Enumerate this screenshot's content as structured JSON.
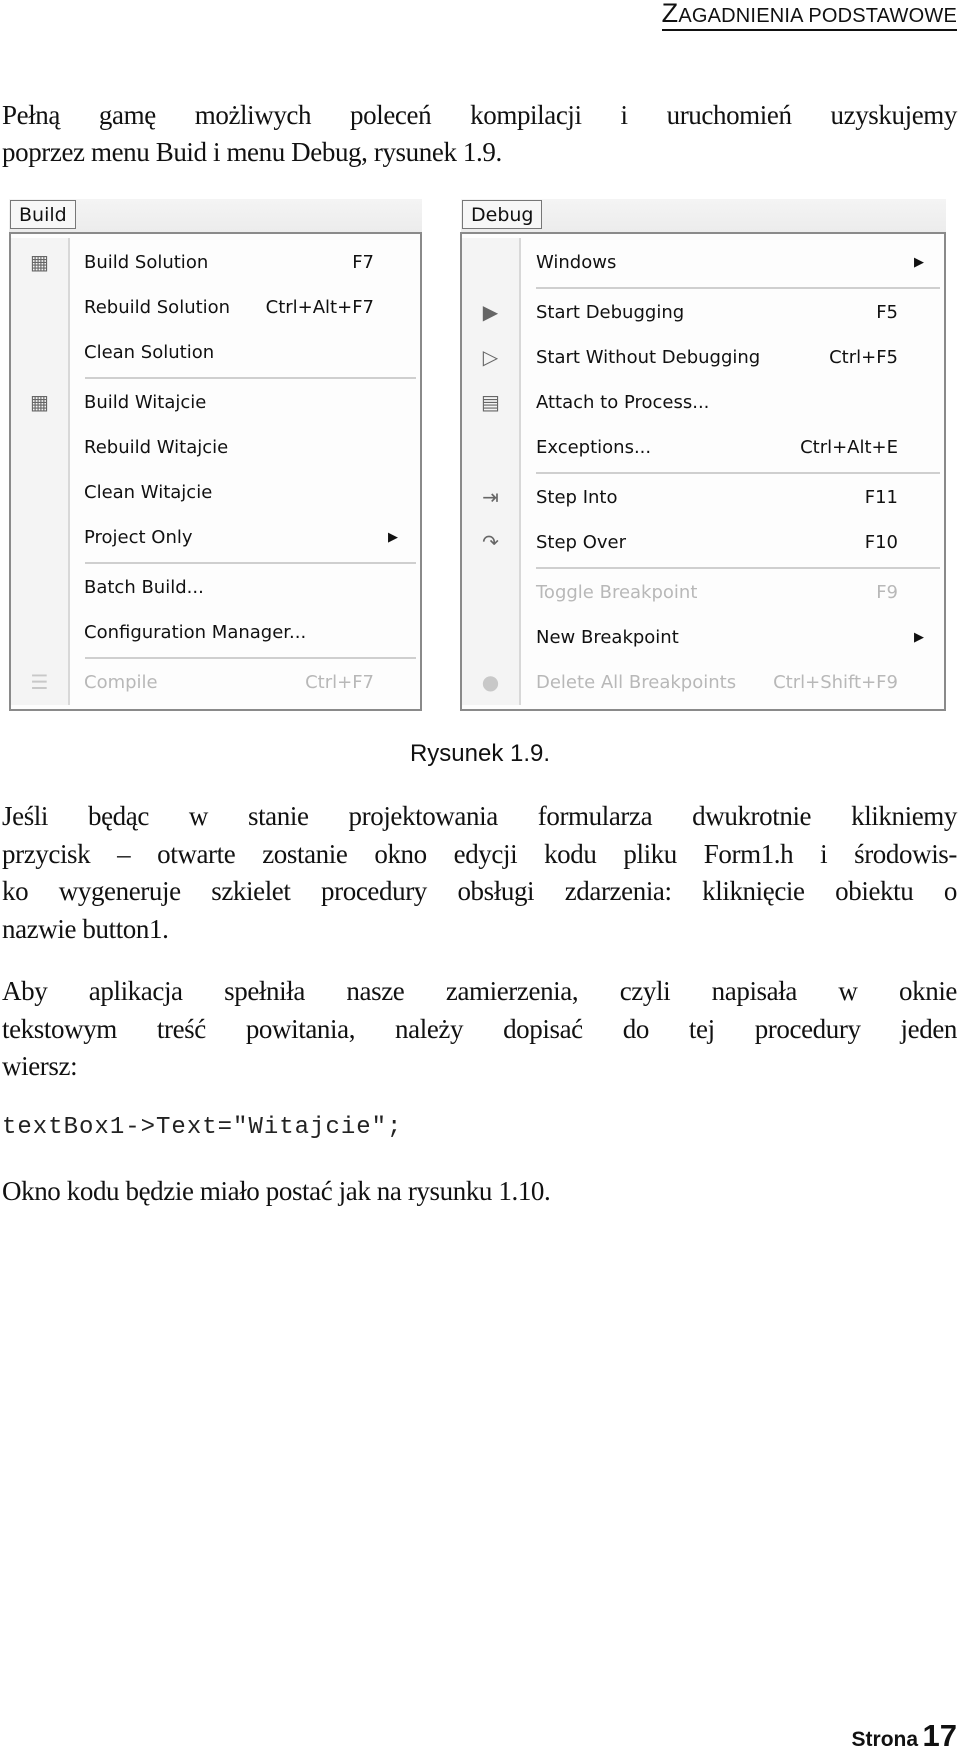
{
  "header": {
    "first_letter": "Z",
    "rest": "agadnienia podstawowe"
  },
  "intro": [
    "Pełną gamę możliwych poleceń kompilacji i uruchomień uzyskujemy",
    "poprzez menu Buid i menu Debug, rysunek 1.9."
  ],
  "build_menu": {
    "title": "Build",
    "items": [
      {
        "type": "item",
        "label": "Build Solution",
        "shortcut": "F7",
        "icon": "build-solution-icon"
      },
      {
        "type": "item",
        "label": "Rebuild Solution",
        "shortcut": "Ctrl+Alt+F7"
      },
      {
        "type": "item",
        "label": "Clean Solution",
        "shortcut": ""
      },
      {
        "type": "separator"
      },
      {
        "type": "item",
        "label": "Build Witajcie",
        "shortcut": "",
        "icon": "build-project-icon"
      },
      {
        "type": "item",
        "label": "Rebuild Witajcie",
        "shortcut": ""
      },
      {
        "type": "item",
        "label": "Clean Witajcie",
        "shortcut": ""
      },
      {
        "type": "item",
        "label": "Project Only",
        "shortcut": "",
        "submenu": true
      },
      {
        "type": "separator"
      },
      {
        "type": "item",
        "label": "Batch Build...",
        "shortcut": ""
      },
      {
        "type": "item",
        "label": "Configuration Manager...",
        "shortcut": ""
      },
      {
        "type": "separator"
      },
      {
        "type": "item",
        "label": "Compile",
        "shortcut": "Ctrl+F7",
        "disabled": true,
        "icon": "compile-icon"
      }
    ]
  },
  "debug_menu": {
    "title": "Debug",
    "items": [
      {
        "type": "item",
        "label": "Windows",
        "shortcut": "",
        "submenu": true
      },
      {
        "type": "separator"
      },
      {
        "type": "item",
        "label": "Start Debugging",
        "shortcut": "F5",
        "icon": "play-icon"
      },
      {
        "type": "item",
        "label": "Start Without Debugging",
        "shortcut": "Ctrl+F5",
        "icon": "play-outline-icon"
      },
      {
        "type": "item",
        "label": "Attach to Process...",
        "shortcut": "",
        "icon": "attach-process-icon"
      },
      {
        "type": "item",
        "label": "Exceptions...",
        "shortcut": "Ctrl+Alt+E"
      },
      {
        "type": "separator"
      },
      {
        "type": "item",
        "label": "Step Into",
        "shortcut": "F11",
        "icon": "step-into-icon"
      },
      {
        "type": "item",
        "label": "Step Over",
        "shortcut": "F10",
        "icon": "step-over-icon"
      },
      {
        "type": "separator"
      },
      {
        "type": "item",
        "label": "Toggle Breakpoint",
        "shortcut": "F9",
        "disabled": true
      },
      {
        "type": "item",
        "label": "New Breakpoint",
        "shortcut": "",
        "submenu": true
      },
      {
        "type": "item",
        "label": "Delete All Breakpoints",
        "shortcut": "Ctrl+Shift+F9",
        "disabled": true,
        "icon": "delete-breakpoints-icon"
      }
    ]
  },
  "caption": "Rysunek 1.9.",
  "para1": [
    "Jeśli będąc w stanie projektowania formularza dwukrotnie klikniemy",
    "przycisk – otwarte zostanie okno edycji kodu pliku Form1.h i środowis-",
    "ko wygeneruje szkielet procedury obsługi zdarzenia: kliknięcie obiektu o",
    "nazwie button1."
  ],
  "para2": [
    "Aby aplikacja spełniła nasze zamierzenia, czyli napisała w oknie",
    "tekstowym treść powitania, należy dopisać do tej procedury jeden",
    "wiersz:"
  ],
  "code": "textBox1->Text=\"Witajcie\";",
  "outro": "Okno kodu będzie miało postać jak na rysunku 1.10.",
  "footer": {
    "label": "Strona",
    "page": "17"
  }
}
